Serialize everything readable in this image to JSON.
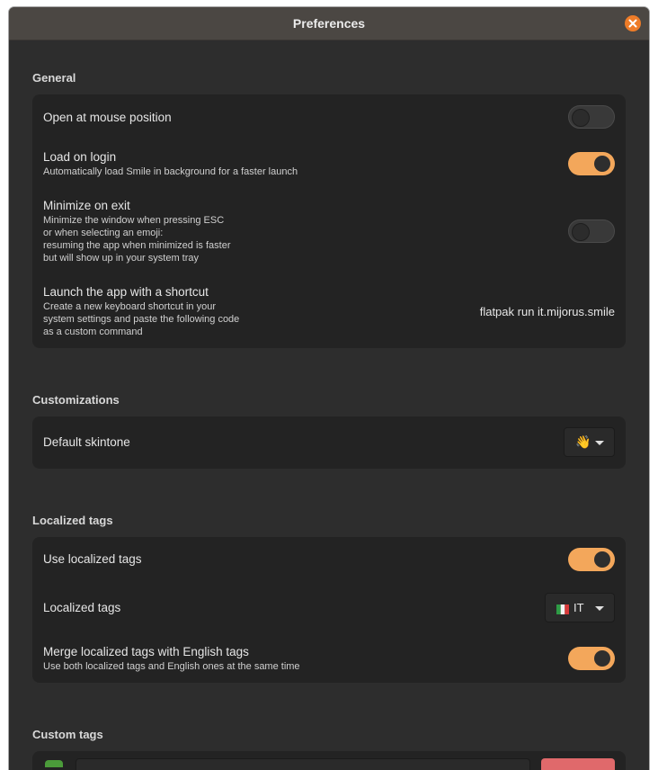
{
  "window": {
    "title": "Preferences"
  },
  "general": {
    "title": "General",
    "open_at_mouse": {
      "label": "Open at mouse position",
      "enabled": false
    },
    "load_on_login": {
      "label": "Load on login",
      "sub": "Automatically load Smile in background for a faster launch",
      "enabled": true
    },
    "minimize_on_exit": {
      "label": "Minimize on exit",
      "sub": [
        "Minimize the window when pressing ESC",
        "or when selecting an emoji:",
        "resuming the app when minimized is faster",
        "but will show up in your system tray"
      ],
      "enabled": false
    },
    "shortcut": {
      "label": "Launch the app with a shortcut",
      "sub": [
        "Create a new keyboard shortcut in your",
        "system settings and paste the following code",
        "as a custom command"
      ],
      "command": "flatpak run it.mijorus.smile"
    }
  },
  "customizations": {
    "title": "Customizations",
    "skintone": {
      "label": "Default skintone",
      "value": "👋"
    }
  },
  "localized_tags": {
    "title": "Localized tags",
    "use": {
      "label": "Use localized tags",
      "enabled": true
    },
    "language": {
      "label": "Localized tags",
      "value": "IT"
    },
    "merge": {
      "label": "Merge localized tags with English tags",
      "sub": "Use both localized tags and English ones at the same time",
      "enabled": true
    }
  },
  "custom_tags": {
    "title": "Custom tags"
  },
  "colors": {
    "accent": "#f3a75b",
    "close": "#ee7c28",
    "card": "#232323",
    "background": "#2d2d2d"
  }
}
